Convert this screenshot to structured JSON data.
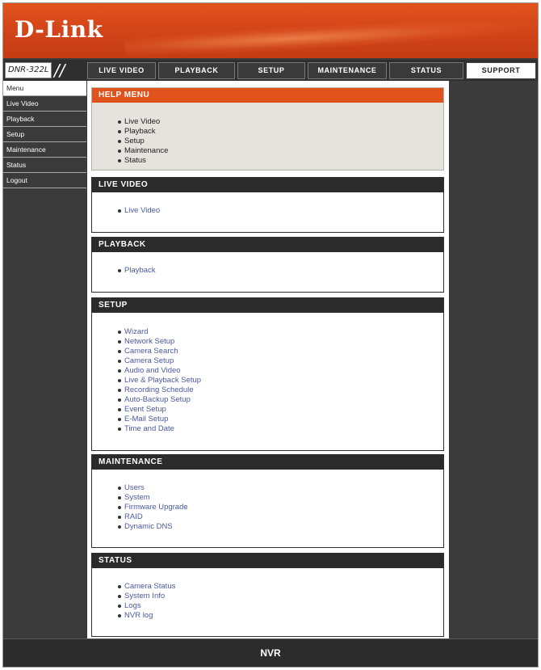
{
  "brand": {
    "logo": "D-Link"
  },
  "nav": {
    "model": "DNR-322L",
    "tabs": [
      {
        "label": "LIVE VIDEO"
      },
      {
        "label": "PLAYBACK"
      },
      {
        "label": "SETUP"
      },
      {
        "label": "MAINTENANCE"
      },
      {
        "label": "STATUS"
      },
      {
        "label": "SUPPORT",
        "active": true
      }
    ]
  },
  "sidebar": {
    "items": [
      {
        "label": "Menu",
        "selected": true
      },
      {
        "label": "Live Video"
      },
      {
        "label": "Playback"
      },
      {
        "label": "Setup"
      },
      {
        "label": "Maintenance"
      },
      {
        "label": "Status"
      },
      {
        "label": "Logout"
      }
    ]
  },
  "sections": {
    "help": {
      "title": "HELP MENU",
      "items": [
        "Live Video",
        "Playback",
        "Setup",
        "Maintenance",
        "Status"
      ]
    },
    "live_video": {
      "title": "LIVE VIDEO",
      "items": [
        "Live Video"
      ]
    },
    "playback": {
      "title": "PLAYBACK",
      "items": [
        "Playback"
      ]
    },
    "setup": {
      "title": "SETUP",
      "items": [
        "Wizard",
        "Network Setup",
        "Camera Search",
        "Camera Setup",
        "Audio and Video",
        "Live & Playback Setup",
        "Recording Schedule",
        "Auto-Backup Setup",
        "Event Setup",
        "E-Mail Setup",
        "Time and Date"
      ]
    },
    "maintenance": {
      "title": "MAINTENANCE",
      "items": [
        "Users",
        "System",
        "Firmware Upgrade",
        "RAID",
        "Dynamic DNS"
      ]
    },
    "status": {
      "title": "STATUS",
      "items": [
        "Camera Status",
        "System Info",
        "Logs",
        "NVR log"
      ]
    }
  },
  "footer": {
    "label": "NVR"
  },
  "colors": {
    "accent": "#e0531d",
    "link": "#4a5aa0",
    "dark": "#2b2b2b"
  }
}
